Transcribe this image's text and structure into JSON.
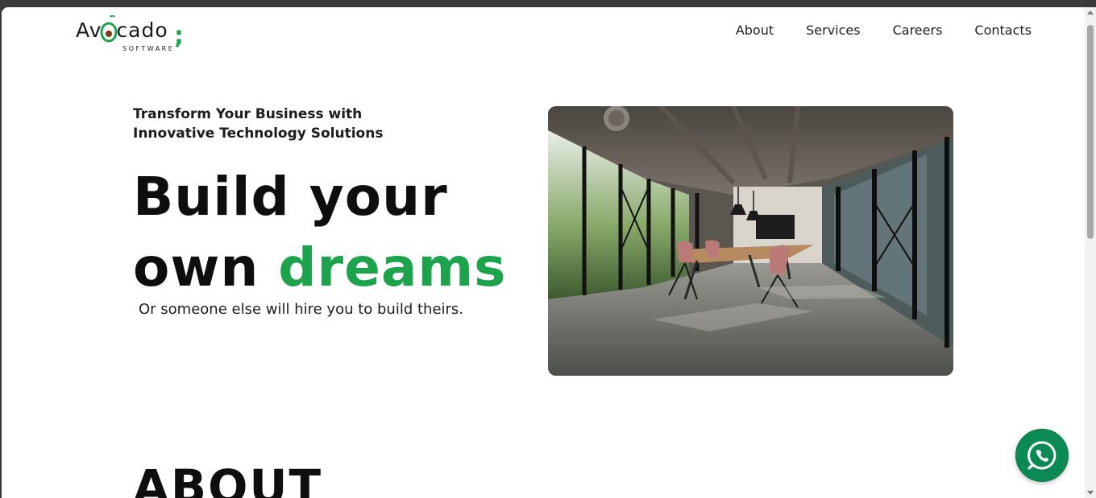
{
  "brand": {
    "name_prefix": "Av",
    "name_suffix": "cado",
    "semicolon": ";",
    "sub": "SOFTWARE",
    "accent_color": "#1ea34d"
  },
  "nav": {
    "items": [
      {
        "label": "About"
      },
      {
        "label": "Services"
      },
      {
        "label": "Careers"
      },
      {
        "label": "Contacts"
      }
    ]
  },
  "hero": {
    "tagline": "Transform Your Business with Innovative Technology Solutions",
    "headline_line1": "Build your",
    "headline_line2_prefix": "own ",
    "headline_highlight": "dreams",
    "subline": "Or someone else will hire you to build theirs.",
    "image_icon": "office-meeting-room-photo"
  },
  "about": {
    "heading": "ABOUT"
  },
  "floating": {
    "whatsapp_icon": "whatsapp-icon",
    "whatsapp_color": "#0c8a55"
  }
}
